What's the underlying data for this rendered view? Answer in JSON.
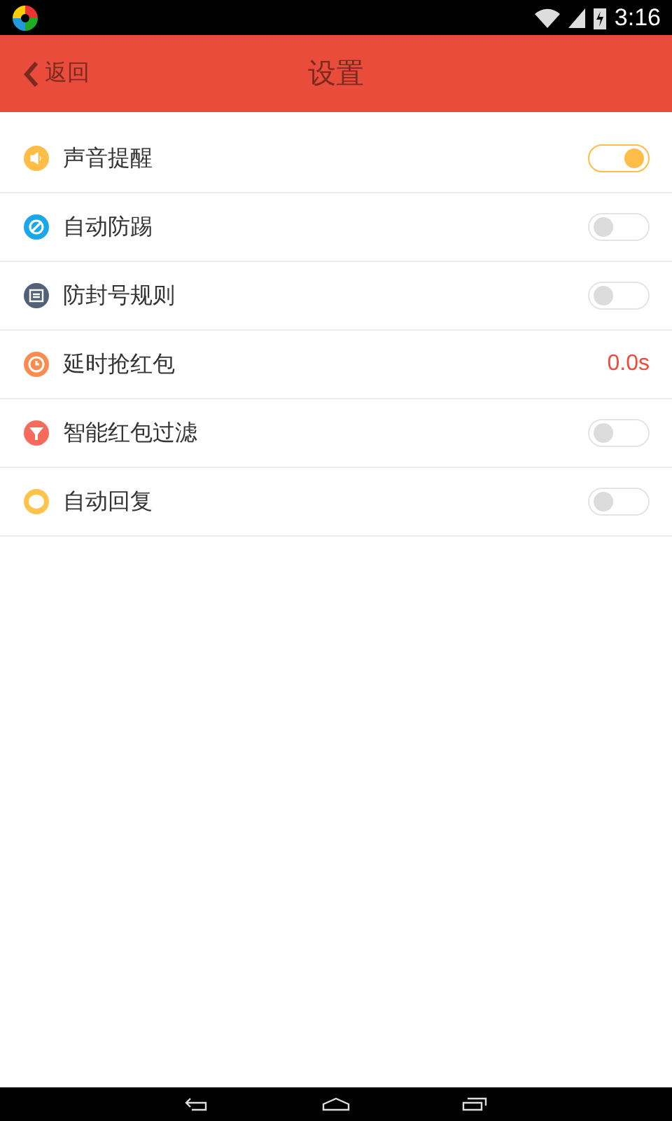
{
  "status_bar": {
    "time": "3:16"
  },
  "header": {
    "back": "返回",
    "title": "设置"
  },
  "settings": [
    {
      "label": "声音提醒",
      "color": "#fdbd47",
      "kind": "toggle",
      "on": true
    },
    {
      "label": "自动防踢",
      "color": "#1aa7ec",
      "kind": "toggle",
      "on": false
    },
    {
      "label": "防封号规则",
      "color": "#52607a",
      "kind": "toggle",
      "on": false
    },
    {
      "label": "延时抢红包",
      "color": "#fb8b4e",
      "kind": "value",
      "value": "0.0s"
    },
    {
      "label": "智能红包过滤",
      "color": "#f86a5c",
      "kind": "toggle",
      "on": false
    },
    {
      "label": "自动回复",
      "color": "#fdc34a",
      "kind": "toggle",
      "on": false
    }
  ]
}
